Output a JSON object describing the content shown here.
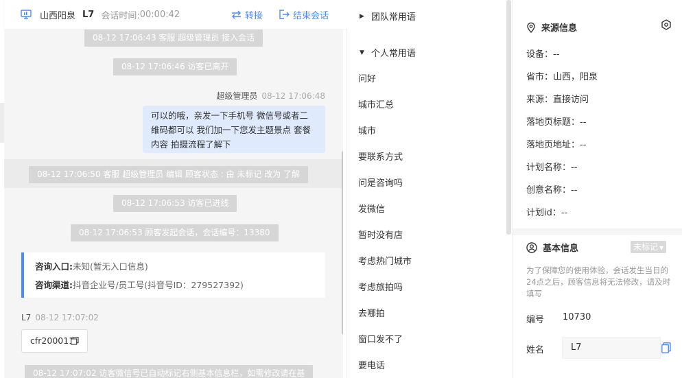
{
  "header": {
    "region": "山西阳泉",
    "visitor_id": "L7",
    "time_label": "会话时间:",
    "time_value": "00:00:42",
    "transfer_label": "转接",
    "end_label": "结束会话"
  },
  "chat": {
    "system_messages": [
      "08-12 17:06:43 客服 超级管理员 接入会话",
      "08-12 17:06:46 访客已离开",
      "08-12 17:06:50 客服 超级管理员 编辑 顾客状态 : 由 未标记 改为 了解",
      "08-12 17:06:53 访客已进线",
      "08-12 17:06:53 顾客发起会话，会话编号：13380",
      "08-12 17:07:02 访客微信号已自动标记右侧基本信息栏，如需修改请在基"
    ],
    "agent_name": "超级管理员",
    "agent_time": "08-12 17:06:48",
    "agent_message_lines": [
      "可以的哦，亲发一下手机号 微信号或者二",
      "维码都可以 我们加一下您发主题景点 套餐",
      "内容 拍摄流程了解下"
    ],
    "consult": {
      "entry_label": "咨询入口:",
      "entry_value": "未知(暂无入口信息)",
      "channel_label": "咨询渠道:",
      "channel_value": "抖音企业号/员工号(抖音号ID：279527392)"
    },
    "visitor_name": "L7",
    "visitor_time": "08-12 17:07:02",
    "visitor_message": "cfr200011"
  },
  "phrases": {
    "team_group": "团队常用语",
    "personal_group": "个人常用语",
    "items": [
      "问好",
      "城市汇总",
      "城市",
      "要联系方式",
      "问是咨询吗",
      "发微信",
      "暂时没有店",
      "考虑热门城市",
      "考虑旅拍吗",
      "去哪拍",
      "窗口发不了",
      "要电话"
    ]
  },
  "source_info": {
    "title": "来源信息",
    "rows": [
      "设备：--",
      "省市：山西，阳泉",
      "来源：直接访问",
      "落地页标题：--",
      "落地页地址：--",
      "计划名称：--",
      "创意名称：--",
      "计划id：--"
    ]
  },
  "basic_info": {
    "title": "基本信息",
    "badge": "未标记",
    "note": "为了保障您的使用体验，会话发生当日的24点之后，顾客信息将无法修改，请及时填写",
    "number_label": "编号",
    "number_value": "10730",
    "name_label": "姓名",
    "name_value": "L7"
  },
  "colors": {
    "accent": "#4a8bf5",
    "bubble": "#dfeafd",
    "system_pill": "#d6d6d6"
  }
}
